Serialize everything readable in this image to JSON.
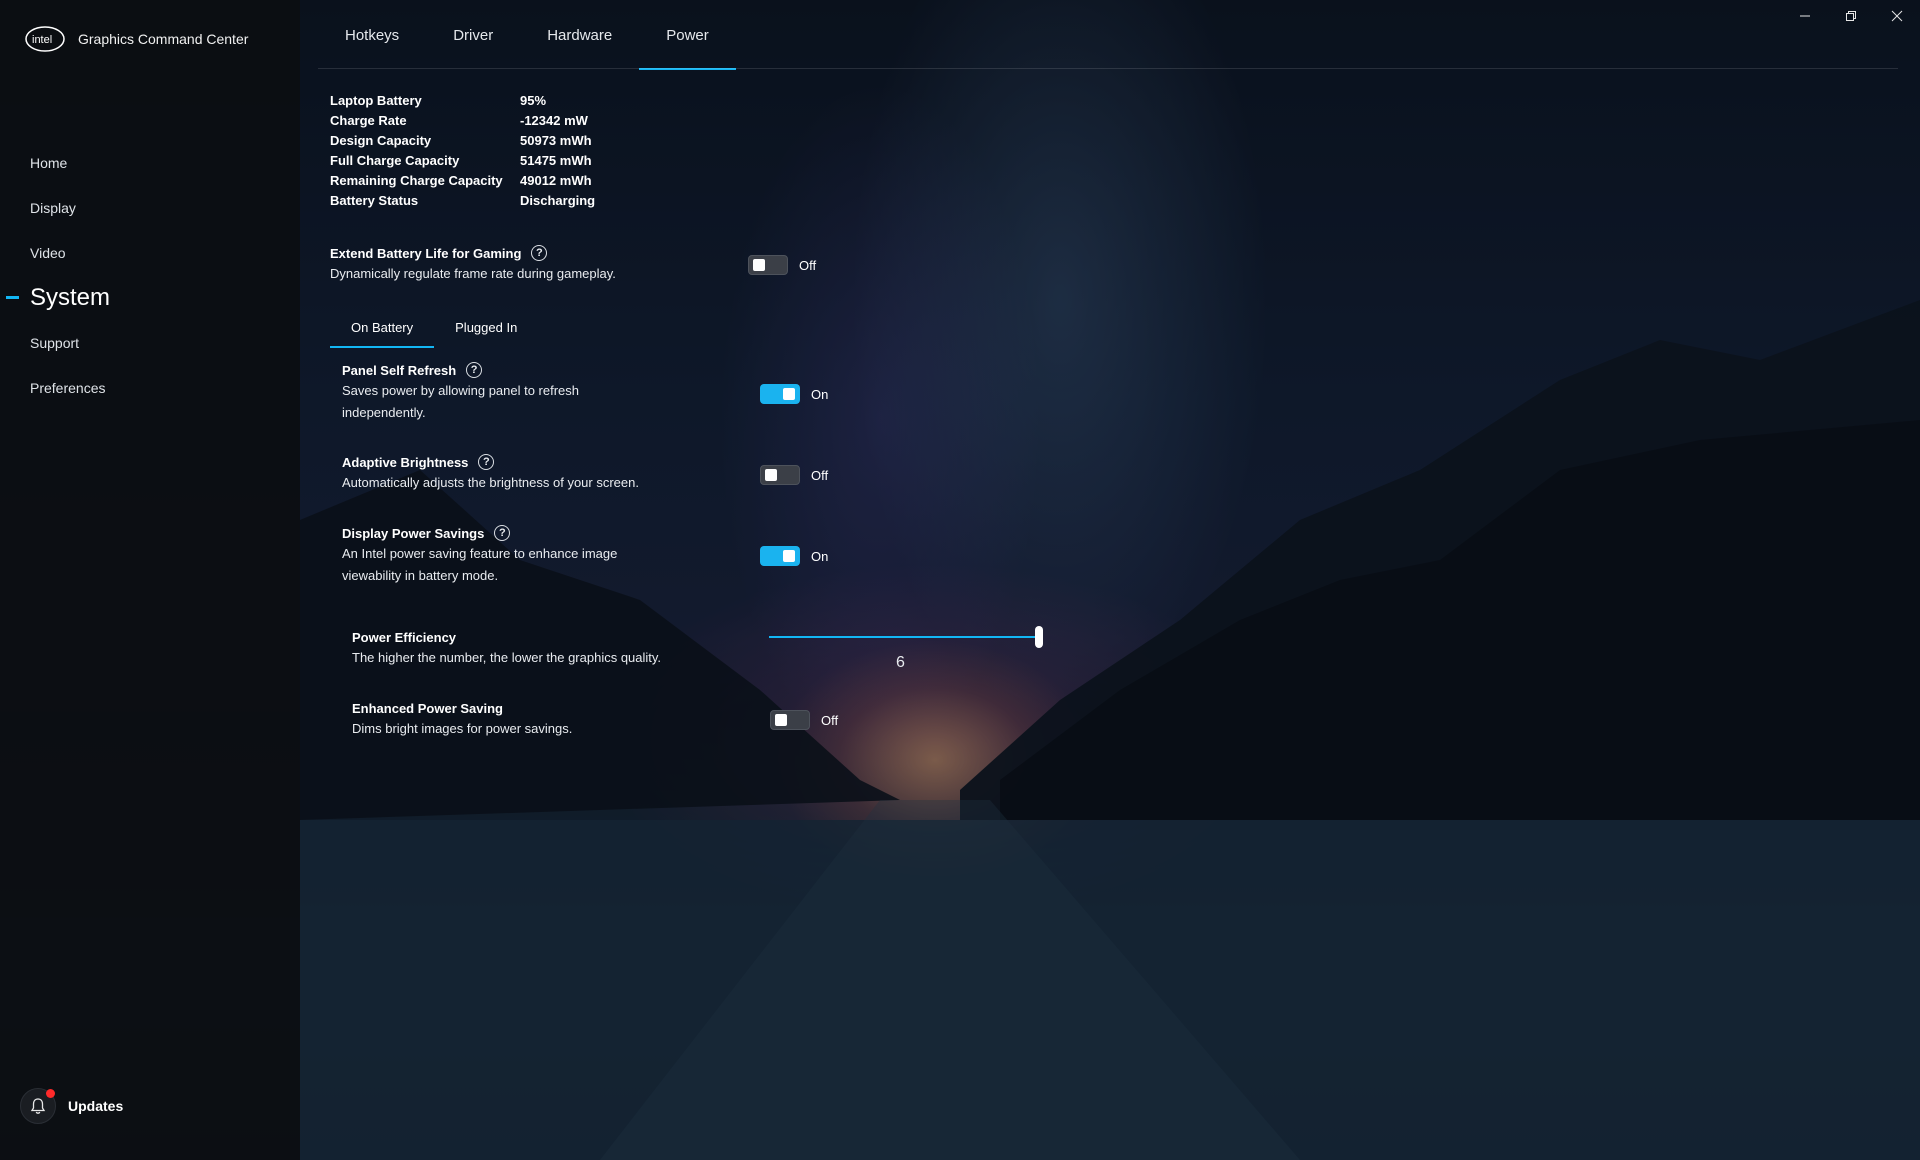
{
  "app": {
    "brand_logo_text": "intel",
    "title": "Graphics Command Center"
  },
  "window_controls": {
    "minimize_icon": "minimize-icon",
    "restore_icon": "restore-icon",
    "close_icon": "close-icon"
  },
  "sidebar": {
    "items": [
      {
        "label": "Home"
      },
      {
        "label": "Display"
      },
      {
        "label": "Video"
      },
      {
        "label": "System",
        "active": true
      },
      {
        "label": "Support"
      },
      {
        "label": "Preferences"
      }
    ],
    "updates_label": "Updates",
    "updates_badge_color": "#ff2a2a"
  },
  "tabs": [
    {
      "label": "Hotkeys"
    },
    {
      "label": "Driver"
    },
    {
      "label": "Hardware"
    },
    {
      "label": "Power",
      "active": true
    }
  ],
  "battery_info": [
    {
      "label": "Laptop Battery",
      "value": "95%"
    },
    {
      "label": "Charge Rate",
      "value": "-12342 mW"
    },
    {
      "label": "Design Capacity",
      "value": "50973 mWh"
    },
    {
      "label": "Full Charge Capacity",
      "value": "51475 mWh"
    },
    {
      "label": "Remaining Charge Capacity",
      "value": "49012 mWh"
    },
    {
      "label": "Battery Status",
      "value": "Discharging"
    }
  ],
  "extend_battery": {
    "title": "Extend Battery Life for Gaming",
    "desc": "Dynamically regulate frame rate during gameplay.",
    "state": "Off"
  },
  "subtabs": [
    {
      "label": "On Battery",
      "active": true
    },
    {
      "label": "Plugged In"
    }
  ],
  "panel_self_refresh": {
    "title": "Panel Self Refresh",
    "desc_line1": "Saves power by allowing panel to refresh",
    "desc_line2": "independently.",
    "state": "On"
  },
  "adaptive_brightness": {
    "title": "Adaptive Brightness",
    "desc": "Automatically adjusts the brightness of your screen.",
    "state": "Off"
  },
  "display_power_savings": {
    "title": "Display Power Savings",
    "desc_line1": "An Intel power saving feature to enhance image",
    "desc_line2": "viewability in battery mode.",
    "state": "On"
  },
  "power_efficiency": {
    "title": "Power Efficiency",
    "desc": "The higher the number, the lower the graphics quality.",
    "value": "6",
    "level_fraction": 1.0
  },
  "enhanced_power_saving": {
    "title": "Enhanced Power Saving",
    "desc": "Dims bright images for power savings.",
    "state": "Off"
  },
  "colors": {
    "accent": "#12b6f4"
  }
}
